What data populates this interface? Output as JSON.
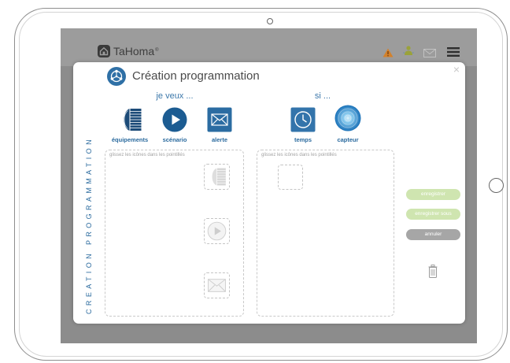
{
  "app": {
    "logo_text": "TaHoma",
    "logo_mark": "®",
    "logo_icon": "house-icon",
    "header_icons": [
      "warning-icon",
      "user-icon",
      "envelope-icon",
      "menu-icon"
    ]
  },
  "dialog": {
    "title": "Création programmation",
    "title_icon": "network-icon",
    "close_label": "×",
    "side_label": "CREATION PROGRAMMATION",
    "actions": {
      "heading": "je veux ...",
      "items": [
        {
          "label": "équipements",
          "icon": "blinds-icon"
        },
        {
          "label": "scénario",
          "icon": "play-icon"
        },
        {
          "label": "alerte",
          "icon": "envelope-icon"
        }
      ]
    },
    "conditions": {
      "heading": "si ...",
      "items": [
        {
          "label": "temps",
          "icon": "clock-icon"
        },
        {
          "label": "capteur",
          "icon": "sensor-icon"
        }
      ]
    },
    "drop_zones": {
      "actions": {
        "hint": "glissez les icônes dans les pointillés",
        "slots": [
          "blinds-icon",
          "play-icon",
          "envelope-icon"
        ]
      },
      "conditions": {
        "hint": "glissez les icônes dans les pointillés"
      }
    },
    "buttons": {
      "save": "enregistrer",
      "save_as": "enregistrer sous",
      "cancel": "annuler",
      "delete_icon": "trash-icon"
    }
  },
  "colors": {
    "primary_blue": "#2a6a9e",
    "save_green": "#cfe5b0",
    "cancel_gray": "#a6a6a6",
    "warning_orange": "#d3812b",
    "overlay_gray": "#8c8c8c"
  }
}
